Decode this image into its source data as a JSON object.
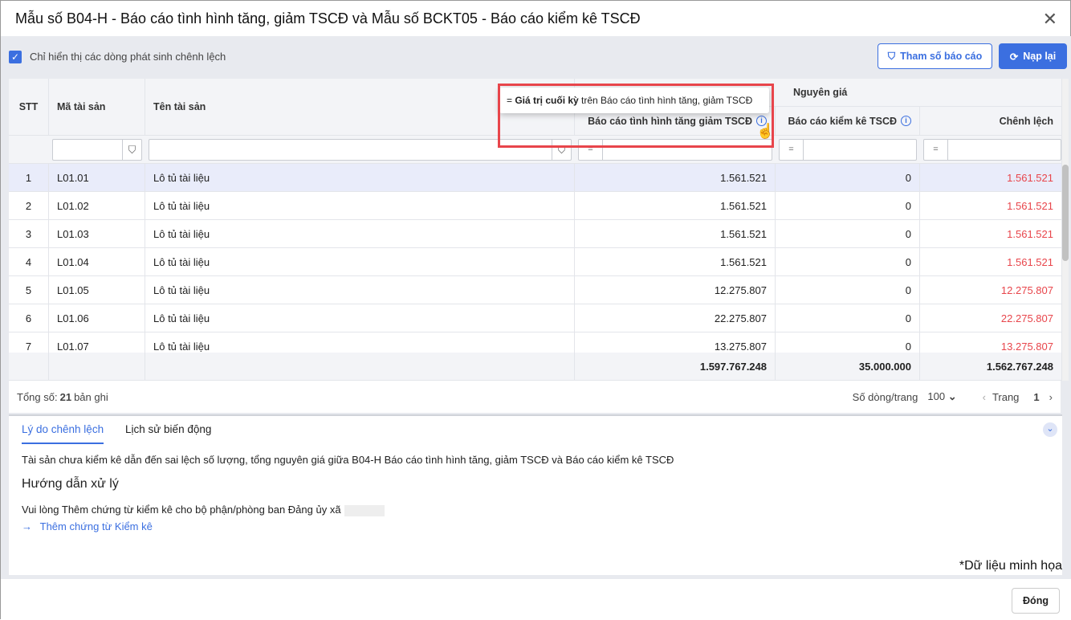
{
  "title": "Mẫu số B04-H - Báo cáo tình hình tăng, giảm TSCĐ và Mẫu số BCKT05 - Báo cáo kiểm kê TSCĐ",
  "toolbar": {
    "checkbox_label": "Chỉ hiển thị các dòng phát sinh chênh lệch",
    "checked": true,
    "params_label": "Tham số báo cáo",
    "reload_label": "Nạp lại"
  },
  "table": {
    "headers": {
      "stt": "STT",
      "code": "Mã tài sản",
      "name": "Tên tài sản",
      "group": "Nguyên giá",
      "report": "Báo cáo tình hình tăng giảm TSCĐ",
      "inventory": "Báo cáo kiểm kê TSCĐ",
      "diff": "Chênh lệch"
    },
    "filter_op": "=",
    "rows": [
      {
        "stt": "1",
        "code": "L01.01",
        "name": "Lô tủ tài liệu",
        "report": "1.561.521",
        "inventory": "0",
        "diff": "1.561.521"
      },
      {
        "stt": "2",
        "code": "L01.02",
        "name": "Lô tủ tài liệu",
        "report": "1.561.521",
        "inventory": "0",
        "diff": "1.561.521"
      },
      {
        "stt": "3",
        "code": "L01.03",
        "name": "Lô tủ tài liệu",
        "report": "1.561.521",
        "inventory": "0",
        "diff": "1.561.521"
      },
      {
        "stt": "4",
        "code": "L01.04",
        "name": "Lô tủ tài liệu",
        "report": "1.561.521",
        "inventory": "0",
        "diff": "1.561.521"
      },
      {
        "stt": "5",
        "code": "L01.05",
        "name": "Lô tủ tài liệu",
        "report": "12.275.807",
        "inventory": "0",
        "diff": "12.275.807"
      },
      {
        "stt": "6",
        "code": "L01.06",
        "name": "Lô tủ tài liệu",
        "report": "22.275.807",
        "inventory": "0",
        "diff": "22.275.807"
      },
      {
        "stt": "7",
        "code": "L01.07",
        "name": "Lô tủ tài liệu",
        "report": "13.275.807",
        "inventory": "0",
        "diff": "13.275.807"
      }
    ],
    "totals": {
      "report": "1.597.767.248",
      "inventory": "35.000.000",
      "diff": "1.562.767.248"
    }
  },
  "tooltip": {
    "prefix": "= ",
    "bold": "Giá trị cuối kỳ",
    "rest": " trên Báo cáo tình hình tăng, giảm TSCĐ"
  },
  "footer": {
    "total_prefix": "Tổng số: ",
    "total_count": "21",
    "total_suffix": " bản ghi",
    "rows_per_page_label": "Số dòng/trang",
    "rows_per_page": "100",
    "page_label": "Trang",
    "page": "1"
  },
  "panel": {
    "tabs": [
      "Lý do chênh lệch",
      "Lịch sử biến động"
    ],
    "reason": "Tài sản chưa kiểm kê dẫn đến sai lệch số lượng, tổng nguyên giá giữa B04-H Báo cáo tình hình tăng, giảm TSCĐ và Báo cáo kiểm kê TSCĐ",
    "guide_title": "Hướng dẫn xử lý",
    "guide_text": "Vui lòng Thêm chứng từ kiểm kê cho bộ phận/phòng ban Đảng ủy xã",
    "link": "Thêm chứng từ Kiểm kê"
  },
  "watermark": "*Dữ liệu minh họa",
  "close_label": "Đóng",
  "colors": {
    "accent": "#3b6fe0",
    "diff": "#e8454b",
    "highlight": "#e8454b"
  }
}
